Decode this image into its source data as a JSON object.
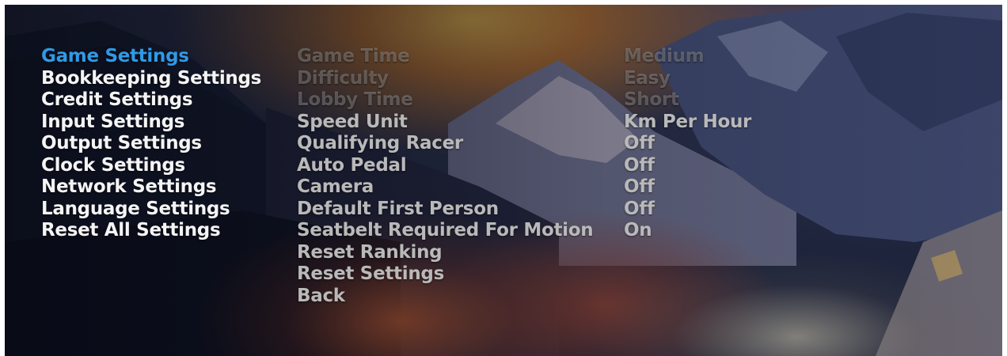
{
  "menu": {
    "items": [
      {
        "label": "Game Settings",
        "active": true
      },
      {
        "label": "Bookkeeping Settings",
        "active": false
      },
      {
        "label": "Credit Settings",
        "active": false
      },
      {
        "label": "Input Settings",
        "active": false
      },
      {
        "label": "Output Settings",
        "active": false
      },
      {
        "label": "Clock Settings",
        "active": false
      },
      {
        "label": "Network Settings",
        "active": false
      },
      {
        "label": "Language Settings",
        "active": false
      },
      {
        "label": "Reset All Settings",
        "active": false
      }
    ]
  },
  "game_settings": {
    "options": [
      {
        "label": "Game Time",
        "value": "Medium"
      },
      {
        "label": "Difficulty",
        "value": "Easy"
      },
      {
        "label": "Lobby Time",
        "value": "Short"
      },
      {
        "label": "Speed Unit",
        "value": "Km Per Hour"
      },
      {
        "label": "Qualifying Racer",
        "value": "Off"
      },
      {
        "label": "Auto Pedal",
        "value": "Off"
      },
      {
        "label": "Camera",
        "value": "Off"
      },
      {
        "label": "Default First Person",
        "value": "Off"
      },
      {
        "label": "Seatbelt Required For Motion",
        "value": "On"
      },
      {
        "label": "Reset Ranking",
        "value": ""
      },
      {
        "label": "Reset Settings",
        "value": ""
      },
      {
        "label": "Back",
        "value": ""
      }
    ]
  },
  "colors": {
    "active_menu": "#2f9ae6",
    "menu_text": "#f4f4f4",
    "option_text": "#b9b9b9"
  }
}
